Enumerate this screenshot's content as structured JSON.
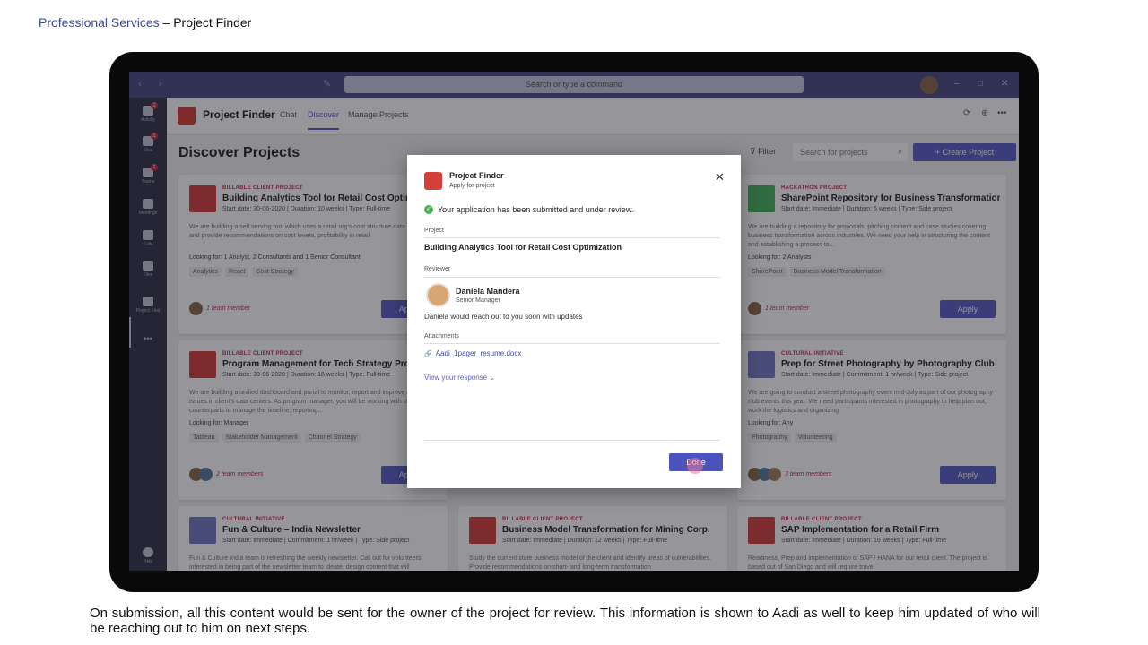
{
  "slide": {
    "title_accent": "Professional Services",
    "title_rest": " – Project Finder",
    "caption": "On submission, all this content  would be sent for the owner of the project for review. This information is shown to Aadi  as well to keep him updated of who will be reaching out to him on next steps."
  },
  "titlebar": {
    "search_placeholder": "Search or type a command",
    "nav": "‹ ›",
    "compose_icon": "✎",
    "min": "–",
    "max": "□",
    "close": "✕"
  },
  "rail": [
    {
      "label": "Activity",
      "badge": "2"
    },
    {
      "label": "Chat",
      "badge": "1"
    },
    {
      "label": "Teams",
      "badge": "1"
    },
    {
      "label": "Meetings",
      "badge": ""
    },
    {
      "label": "Calls",
      "badge": ""
    },
    {
      "label": "Files",
      "badge": ""
    },
    {
      "label": "Project Find",
      "badge": ""
    },
    {
      "label": "",
      "badge": ""
    }
  ],
  "rail_more": "•••",
  "rail_help": "Help",
  "app": {
    "name": "Project Finder",
    "tabs": [
      "Chat",
      "Discover",
      "Manage Projects"
    ],
    "icons": [
      "⟳",
      "⊕",
      "•••"
    ]
  },
  "discover": {
    "title": "Discover Projects",
    "filter": "Filter",
    "search_placeholder": "Search for projects",
    "create": "+ Create Project"
  },
  "cards": [
    {
      "cat": "BILLABLE CLIENT PROJECT",
      "title": "Building Analytics Tool for Retail Cost Optimiza...",
      "meta": "Start date: 30-06-2020  |  Duration: 10 weeks  |  Type: Full-time",
      "desc": "We are building a self serving tool which uses a retail org's cost structure data to analyze and provide recommendations on cost levers, profitability in retail",
      "looking": "Looking for: 1 Analyst, 2 Consultants and 1 Senior Consultant",
      "tags": [
        "Analytics",
        "React",
        "Cost Strategy"
      ],
      "team": "1 team member",
      "apply": "Apply"
    },
    {
      "cat": "HACKATHON PROJECT",
      "title": "SharePoint Repository for Business Transformation..",
      "meta": "Start date: Immediate  |  Duration: 6 weeks  |  Type: Side project",
      "desc": "We are building a repository for proposals, pitching content and case studies covering business transformation across industries. We need your help in structuring the content and establishing a process to...",
      "looking": "Looking for: 2 Analysts",
      "tags": [
        "SharePoint",
        "Business Model Transformation"
      ],
      "team": "1 team member",
      "apply": "Apply"
    },
    {
      "cat": "BILLABLE CLIENT PROJECT",
      "title": "Program Management for Tech Strategy Project",
      "meta": "Start date: 30-06-2020  |  Duration: 18 weeks  |  Type: Full-time",
      "desc": "We are building a unified dashboard and portal to monitor, report and improve analyze issues in client's data centers. As program manager, you will be working with client counterparts to manage the timeline, reporting...",
      "looking": "Looking for: Manager",
      "tags": [
        "Tableau",
        "Stakeholder Management",
        "Channel Strategy"
      ],
      "team": "2 team members",
      "apply": "Apply"
    },
    {
      "cat": "CULTURAL INITIATIVE",
      "title": "Prep for Street Photography by Photography Club",
      "meta": "Start date: Immediate  |  Commitment: 1 hr/week  |  Type: Side project",
      "desc": "We are going to conduct a street photography event mid-July as part of our photography club events this year. We need participants interested in photography to help plan out, work the logistics and organizing",
      "looking": "Looking for: Any",
      "tags": [
        "Photography",
        "Volunteering"
      ],
      "team": "3 team members",
      "apply": "Apply"
    },
    {
      "cat": "CULTURAL INITIATIVE",
      "title": "Fun & Culture – India Newsletter",
      "meta": "Start date: Immediate  |  Commitment: 1 hr/week  |  Type: Side project",
      "desc": "Fun & Culture India team is refreshing the weekly newsletter. Call out for volunteers interested in being part of the newsletter team to ideate, design content that will",
      "looking": "",
      "tags": [],
      "team": "",
      "apply": ""
    },
    {
      "cat": "BILLABLE CLIENT PROJECT",
      "title": "Business Model Transformation for Mining Corp.",
      "meta": "Start date: Immediate  |  Duration: 12 weeks  |  Type: Full-time",
      "desc": "Study the current state business model of the client and identify areas of vulnerabilities. Provide recommendations on short- and long-term transformation",
      "looking": "",
      "tags": [],
      "team": "",
      "apply": ""
    },
    {
      "cat": "BILLABLE CLIENT PROJECT",
      "title": "SAP Implementation for a Retail Firm",
      "meta": "Start date: Immediate  |  Duration: 16 weeks  |  Type: Full-time",
      "desc": "Readiness, Prep and implementation of SAP / HANA for our retail client. The project is based out of San Diego and will require travel",
      "looking": "",
      "tags": [],
      "team": "",
      "apply": ""
    }
  ],
  "modal": {
    "app": "Project Finder",
    "sub": "Apply for project",
    "close": "✕",
    "status": "Your application has been submitted and under review.",
    "check": "✓",
    "project_label": "Project",
    "project": "Building Analytics Tool for Retail Cost Optimization",
    "reviewer_label": "Reviewer",
    "reviewer_name": "Daniela Mandera",
    "reviewer_role": "Senior Manager",
    "note": "Daniela would reach out to you soon with updates",
    "attach_label": "Attachments",
    "attach_icon": "🔗",
    "attachment": "Aadi_1pager_resume.docx",
    "view": "View your response ⌄",
    "done": "Done"
  }
}
